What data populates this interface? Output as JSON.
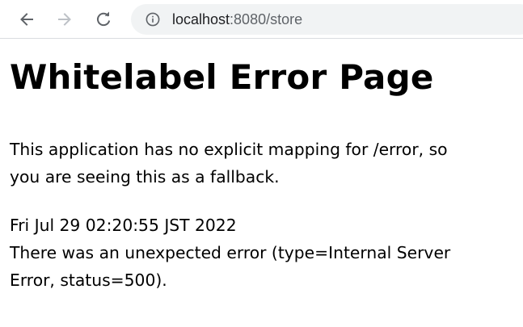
{
  "browser": {
    "url_host": "localhost",
    "url_rest": ":8080/store",
    "icons": {
      "back": "back-arrow-icon",
      "forward": "forward-arrow-icon",
      "reload": "reload-icon",
      "info": "info-icon"
    }
  },
  "page": {
    "title": "Whitelabel Error Page",
    "message_line1": "This application has no explicit mapping for /error, so",
    "message_line2": "you are seeing this as a fallback.",
    "timestamp": "Fri Jul 29 02:20:55 JST 2022",
    "error_line1": "There was an unexpected error (type=Internal Server",
    "error_line2": "Error, status=500)."
  }
}
